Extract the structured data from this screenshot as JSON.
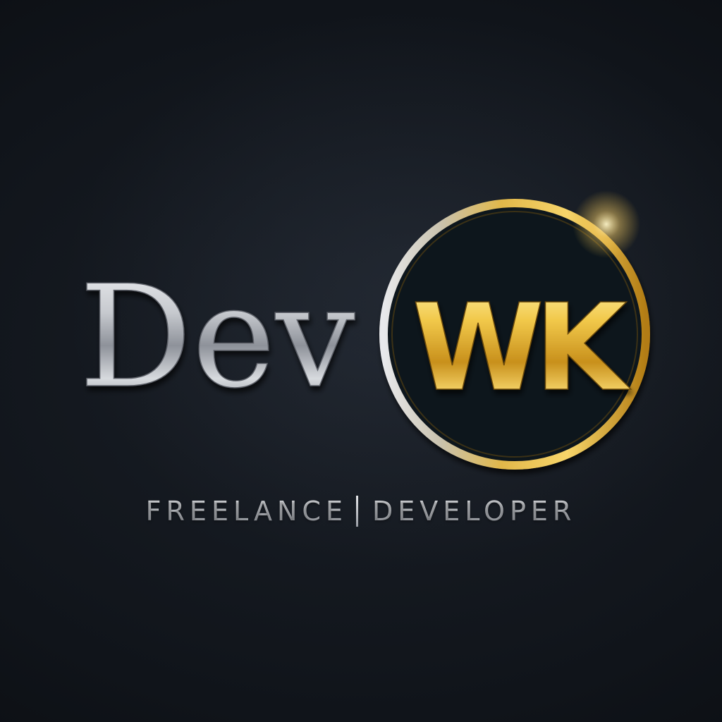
{
  "logo": {
    "wordmark": "Dev",
    "monogram": "WK",
    "tagline_left": "FREELANCE",
    "tagline_right": "DEVELOPER"
  },
  "colors": {
    "background": "#10141a",
    "silver": "#c9ccd1",
    "gold": "#d9a928"
  }
}
